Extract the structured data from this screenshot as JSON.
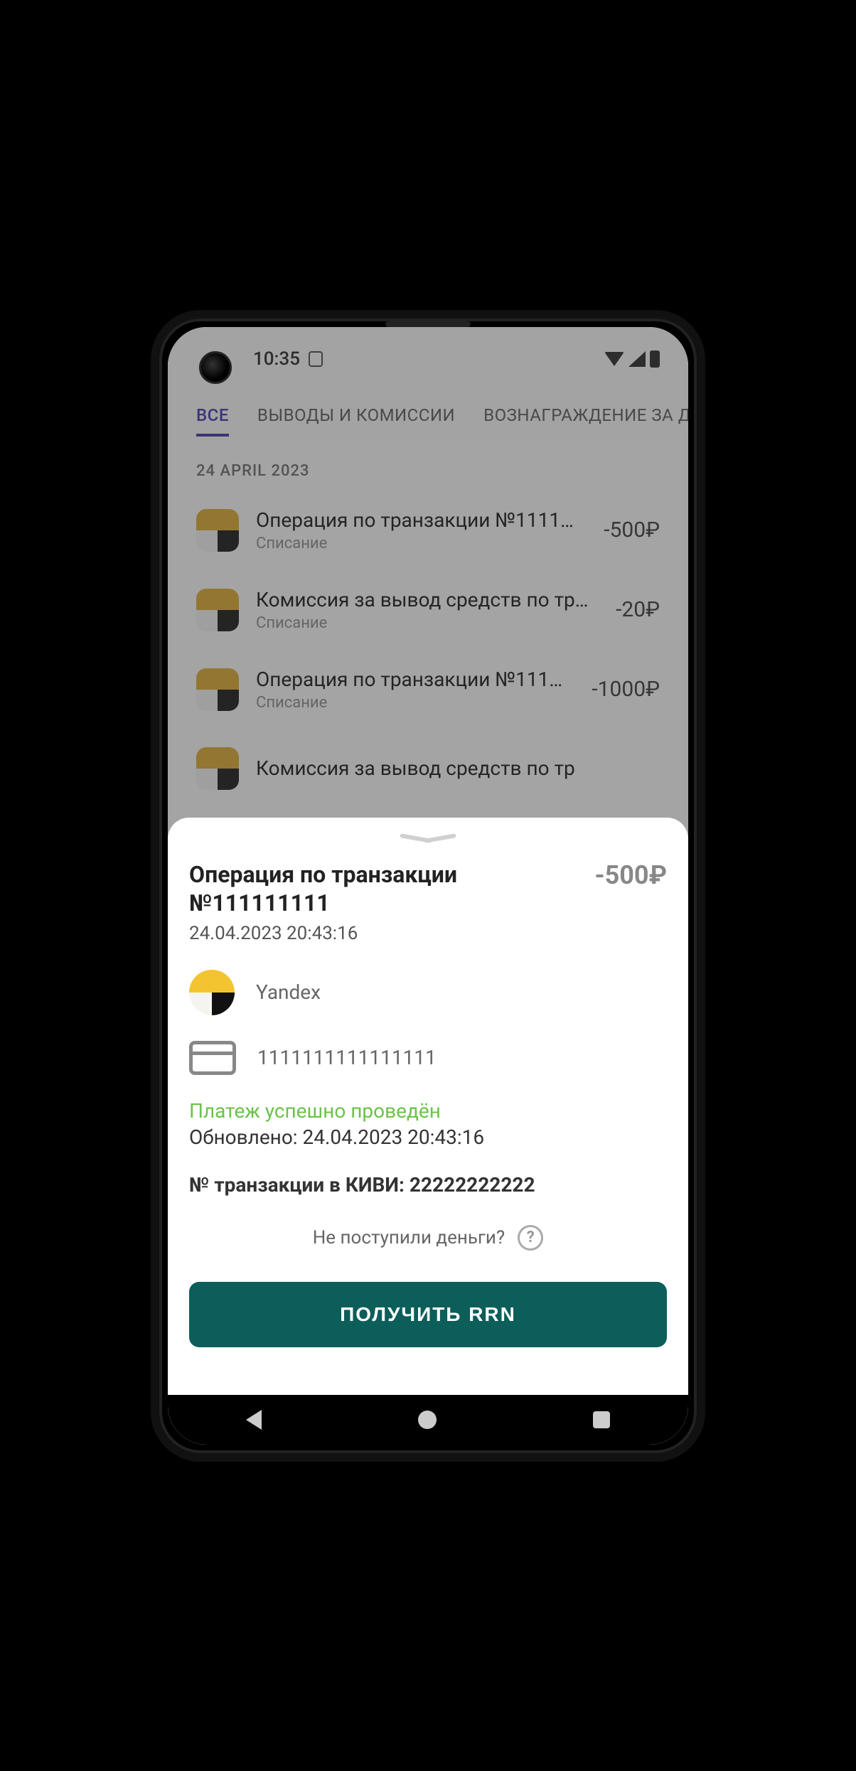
{
  "status_bar": {
    "time": "10:35"
  },
  "tabs": [
    {
      "label": "ВСЕ",
      "active": true
    },
    {
      "label": "ВЫВОДЫ И КОМИССИИ",
      "active": false
    },
    {
      "label": "ВОЗНАГРАЖДЕНИЕ ЗА ДР",
      "active": false
    }
  ],
  "date_header": "24 APRIL 2023",
  "transactions": [
    {
      "title": "Операция по транзакции №1111…",
      "subtitle": "Списание",
      "amount": "-500₽"
    },
    {
      "title": "Комиссия за вывод средств по тр…",
      "subtitle": "Списание",
      "amount": "-20₽"
    },
    {
      "title": "Операция по транзакции №111…",
      "subtitle": "Списание",
      "amount": "-1000₽"
    },
    {
      "title": "Комиссия за вывод средств по тр",
      "subtitle": "",
      "amount": ""
    }
  ],
  "sheet": {
    "title": "Операция по транзакции №111111111",
    "amount": "-500₽",
    "datetime": "24.04.2023 20:43:16",
    "company": "Yandex",
    "card_number": "1111111111111111",
    "status": "Платеж успешно проведён",
    "updated": "Обновлено: 24.04.2023 20:43:16",
    "qiwi_label": "№ транзакции в КИВИ:",
    "qiwi_value": "22222222222",
    "help_text": "Не поступили деньги?",
    "cta": "ПОЛУЧИТЬ RRN"
  }
}
